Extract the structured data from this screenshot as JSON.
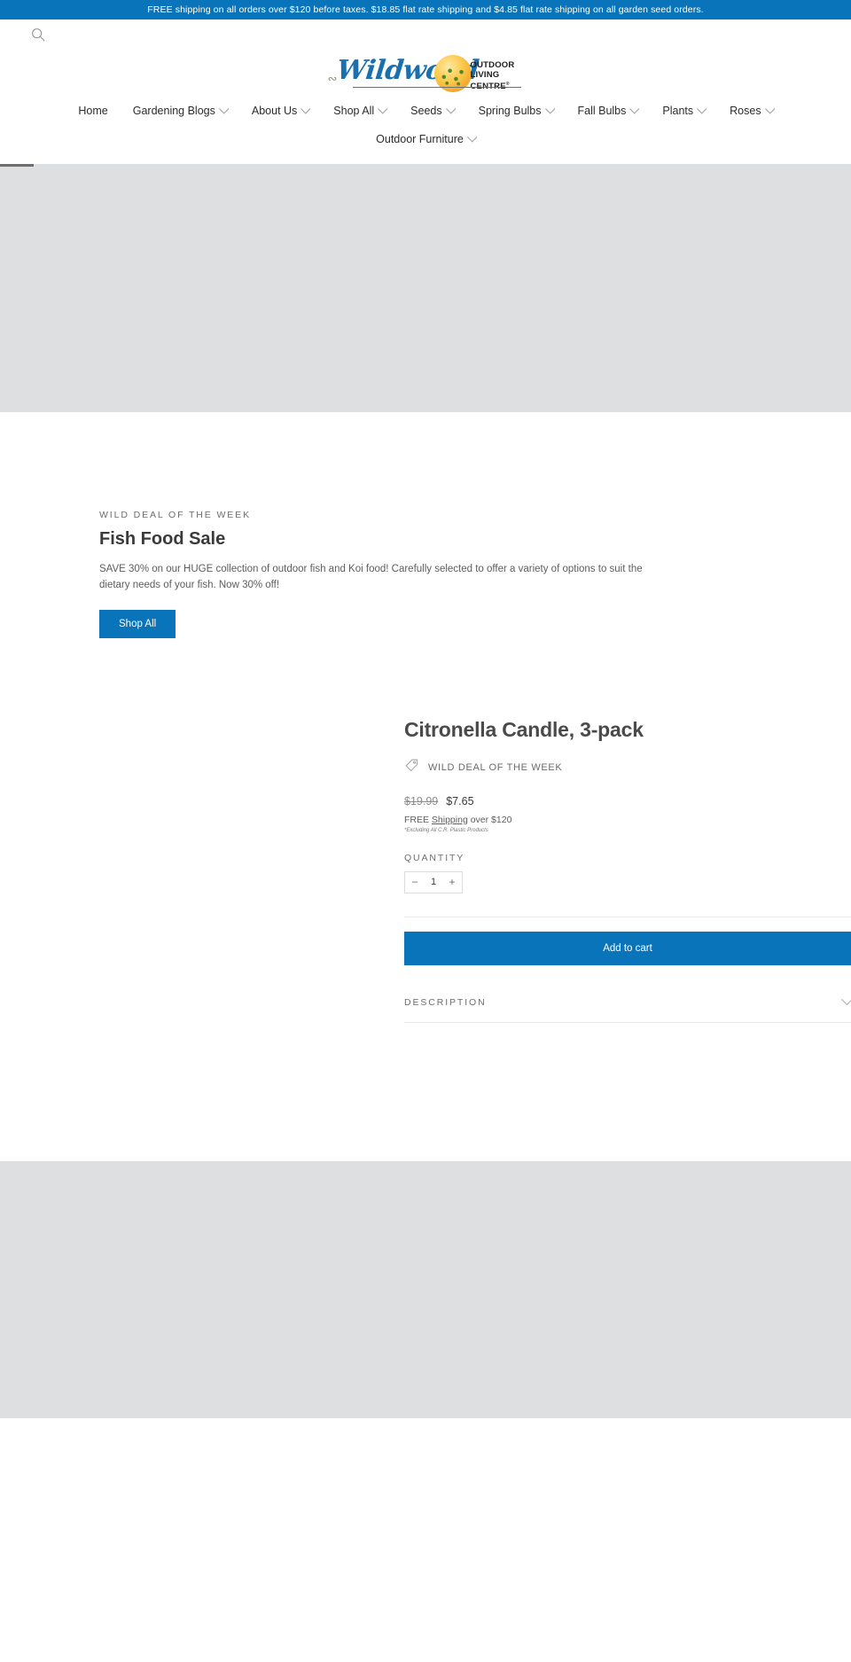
{
  "announcement": {
    "text": "FREE shipping on all orders over $120 before taxes. $18.85 flat rate shipping and $4.85 flat rate shipping on all garden seed orders."
  },
  "header": {
    "search_icon": "search-icon",
    "logo": {
      "wordmark": "Wildwood",
      "tagline_line1": "OUTDOOR",
      "tagline_line2": "LIVING CENTRE",
      "trademark": "®"
    }
  },
  "nav": {
    "row1": [
      {
        "label": "Home",
        "has_caret": false
      },
      {
        "label": "Gardening Blogs",
        "has_caret": true
      },
      {
        "label": "About Us",
        "has_caret": true
      },
      {
        "label": "Shop All",
        "has_caret": true
      },
      {
        "label": "Seeds",
        "has_caret": true
      },
      {
        "label": "Spring Bulbs",
        "has_caret": true
      },
      {
        "label": "Fall Bulbs",
        "has_caret": true
      },
      {
        "label": "Plants",
        "has_caret": true
      },
      {
        "label": "Roses",
        "has_caret": true
      }
    ],
    "row2": [
      {
        "label": "Outdoor Furniture",
        "has_caret": true
      }
    ]
  },
  "deal": {
    "eyebrow": "WILD DEAL OF THE WEEK",
    "title": "Fish Food Sale",
    "description": "SAVE 30% on our HUGE collection of outdoor fish and Koi food! Carefully selected to offer a variety of options to suit the dietary needs of your fish. Now 30% off!",
    "button_label": "Shop All"
  },
  "product": {
    "title": "Citronella Candle, 3-pack",
    "badge": {
      "icon": "tag-icon",
      "label": "WILD DEAL OF THE WEEK"
    },
    "price_compare": "$19.99",
    "price_current": "$7.65",
    "shipping_prefix": "FREE ",
    "shipping_link": "Shipping",
    "shipping_suffix": " over $120",
    "fineprint": "*Excluding All C.R. Plastic Products",
    "quantity_label": "QUANTITY",
    "quantity_decrease": "−",
    "quantity_value": "1",
    "quantity_increase": "+",
    "add_to_cart_label": "Add to cart",
    "description_label": "DESCRIPTION"
  },
  "colors": {
    "brand_blue": "#0a74ba",
    "placeholder_grey": "#dedfe1",
    "text_dark": "#3a3a3a"
  }
}
